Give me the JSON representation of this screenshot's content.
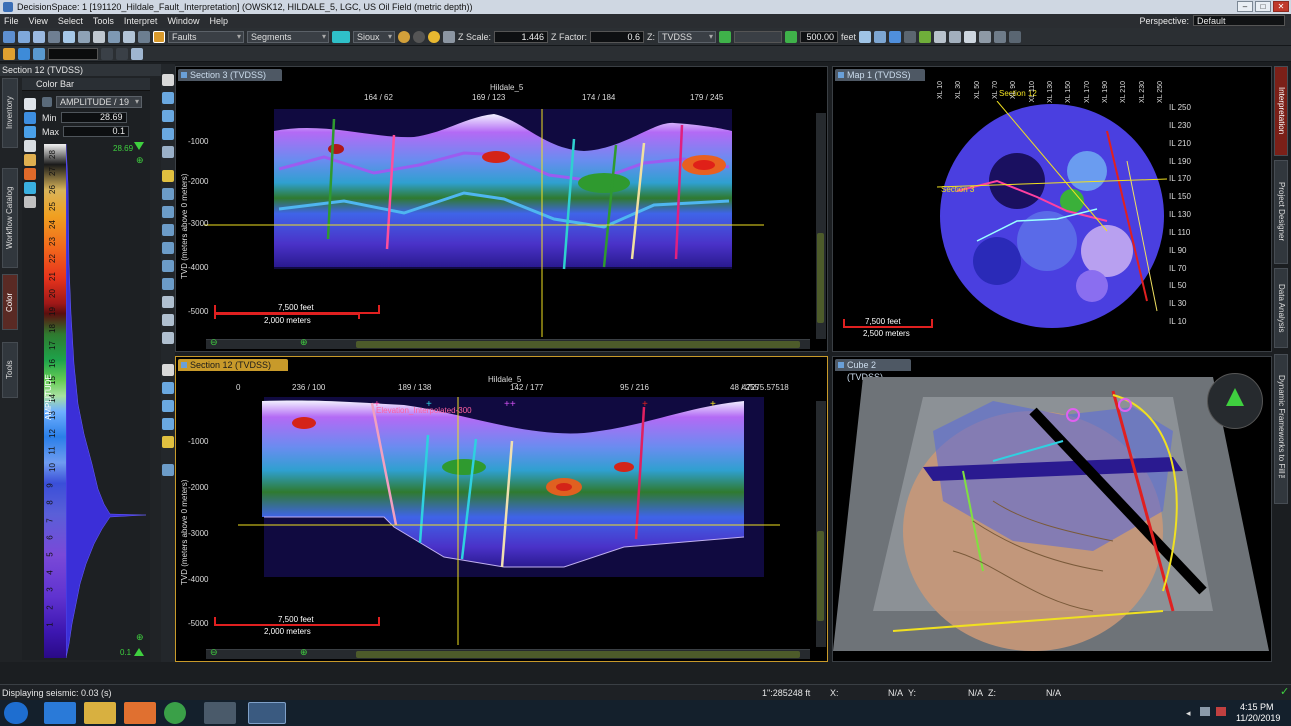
{
  "window": {
    "title": "DecisionSpace: 1 [191120_Hildale_Fault_Interpretation] (OWSK12, HILDALE_5, LGC, US Oil Field (metric depth))",
    "controls": [
      "–",
      "□",
      "✕"
    ]
  },
  "menu": {
    "items": [
      "File",
      "View",
      "Select",
      "Tools",
      "Interpret",
      "Window",
      "Help"
    ],
    "perspective_label": "Perspective:",
    "perspective_value": "Default"
  },
  "toolbar": {
    "faults_label": "Faults",
    "segments_label": "Segments",
    "color_label": "Sioux",
    "z_scale_label": "Z Scale:",
    "z_scale_value": "1.446",
    "z_factor_label": "Z Factor:",
    "z_factor_value": "0.6",
    "z_domain_label": "Z:",
    "z_domain_value": "TVDSS",
    "step_value": "500.00",
    "step_unit": "feet"
  },
  "left_panel": {
    "title": "Section 12 (TVDSS)",
    "vtabs": [
      "Inventory",
      "Workflow Catalog",
      "Color",
      "Tools"
    ],
    "colorbar_title": "Color Bar",
    "attribute": "AMPLITUDE / 19",
    "min_label": "Min",
    "min_value": "28.69",
    "max_label": "Max",
    "max_value": "0.1",
    "ramp_top_value": "28.69",
    "ramp_bottom_value": "0.1",
    "ramp_axis_label": "AMPLITUDE",
    "ramp_ticks": [
      "28",
      "27",
      "26",
      "25",
      "24",
      "23",
      "22",
      "21",
      "20",
      "19",
      "18",
      "17",
      "16",
      "15",
      "14",
      "13",
      "12",
      "11",
      "10",
      "9",
      "8",
      "7",
      "6",
      "5",
      "4",
      "3",
      "2",
      "1"
    ]
  },
  "section3": {
    "tab": "Section 3 (TVDSS)",
    "well": "Hildale_5",
    "top_ticks": [
      "164 / 62",
      "169 / 123",
      "174 / 184",
      "179 / 245"
    ],
    "y_ticks": [
      "-1000",
      "-2000",
      "-3000",
      "-4000",
      "-5000"
    ],
    "y_axis_label": "TVD (meters above 0 meters)",
    "scale_feet": "7,500 feet",
    "scale_meters": "2,000 meters"
  },
  "map1": {
    "tab": "Map 1 (TVDSS)",
    "top_ticks": [
      "XL 10",
      "XL 30",
      "XL 50",
      "XL 70",
      "XL 90",
      "XL 110",
      "XL 130",
      "XL 150",
      "XL 170",
      "XL 190",
      "XL 210",
      "XL 230",
      "XL 250"
    ],
    "right_ticks": [
      "IL 250",
      "IL 230",
      "IL 210",
      "IL 190",
      "IL 170",
      "IL 150",
      "IL 130",
      "IL 110",
      "IL 90",
      "IL 70",
      "IL 50",
      "IL 30",
      "IL 10"
    ],
    "section_label": "Section 12",
    "section3_label": "Section 3",
    "scale_feet": "7,500 feet",
    "scale_meters": "2,500 meters"
  },
  "section12": {
    "tab": "Section 12 (TVDSS)",
    "well": "Hildale_5",
    "top_ticks": [
      "0",
      "236 / 100",
      "189 / 138",
      "142 / 177",
      "95 / 216",
      "48 / 255",
      "47275.57518"
    ],
    "horizon_label": "Elevation_Interpolated-300",
    "y_ticks": [
      "-1000",
      "-2000",
      "-3000",
      "-4000",
      "-5000"
    ],
    "y_axis_label": "TVD (meters above 0 meters)",
    "scale_feet": "7,500 feet",
    "scale_meters": "2,000 meters"
  },
  "cube2": {
    "tab": "Cube 2 (TVDSS)"
  },
  "right_tabs": [
    "Interpretation",
    "Project Designer",
    "Data Analysis",
    "Dynamic Frameworks to Fill™"
  ],
  "status": {
    "message": "Displaying seismic: 0.03 (s)",
    "scale_readout": "1\":285248 ft",
    "x_label": "X:",
    "x_value": "N/A",
    "y_label": "Y:",
    "y_value": "N/A",
    "z_label": "Z:",
    "z_value": "N/A"
  },
  "taskbar": {
    "time": "4:15 PM",
    "date": "11/20/2019"
  },
  "colors": {
    "accent": "#c89a2a",
    "fault_red": "#e02020",
    "crosshair_yellow": "#f0e020",
    "seismic_blue": "#3b2fd8"
  }
}
